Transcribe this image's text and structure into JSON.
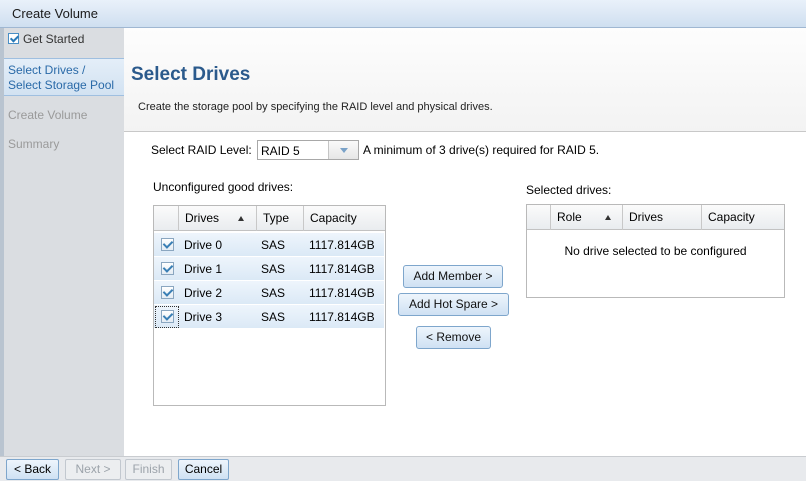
{
  "window": {
    "title": "Create Volume"
  },
  "sidebar": {
    "items": [
      {
        "label": "Get Started",
        "state": "done"
      },
      {
        "label_line1": "Select Drives /",
        "label_line2": "Select Storage Pool",
        "state": "active"
      },
      {
        "label": "Create Volume",
        "state": "pending"
      },
      {
        "label": "Summary",
        "state": "pending"
      }
    ]
  },
  "header": {
    "title": "Select Drives",
    "subtitle": "Create the storage pool by specifying the RAID level and physical drives."
  },
  "raid": {
    "label": "Select RAID Level:",
    "selected": "RAID 5",
    "hint": "A minimum of 3 drive(s) required for RAID 5."
  },
  "unconfigured": {
    "label": "Unconfigured good drives:",
    "columns": [
      "Drives",
      "Type",
      "Capacity"
    ],
    "rows": [
      {
        "drive": "Drive 0",
        "type": "SAS",
        "capacity": "1117.814GB",
        "checked": true
      },
      {
        "drive": "Drive 1",
        "type": "SAS",
        "capacity": "1117.814GB",
        "checked": true
      },
      {
        "drive": "Drive 2",
        "type": "SAS",
        "capacity": "1117.814GB",
        "checked": true
      },
      {
        "drive": "Drive 3",
        "type": "SAS",
        "capacity": "1117.814GB",
        "checked": true
      }
    ]
  },
  "selected": {
    "label": "Selected drives:",
    "columns": [
      "Role",
      "Drives",
      "Capacity"
    ],
    "empty_message": "No drive selected to be configured"
  },
  "actions": {
    "add_member": "Add Member >",
    "add_hot_spare": "Add Hot Spare >",
    "remove": "< Remove"
  },
  "footer": {
    "back": "< Back",
    "next": "Next >",
    "finish": "Finish",
    "cancel": "Cancel"
  },
  "colors": {
    "accent": "#2b5a8c",
    "selection": "#dbe9f6",
    "button_border": "#7ea6cc"
  }
}
